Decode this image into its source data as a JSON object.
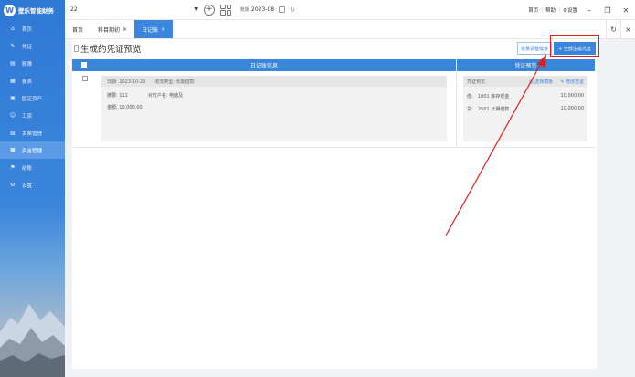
{
  "app": {
    "name": "壁乐智能财务"
  },
  "sidebar": {
    "items": [
      {
        "label": "首页",
        "icon": "home-icon"
      },
      {
        "label": "凭证",
        "icon": "edit-icon"
      },
      {
        "label": "账簿",
        "icon": "book-icon"
      },
      {
        "label": "报表",
        "icon": "report-icon"
      },
      {
        "label": "固定资产",
        "icon": "asset-icon"
      },
      {
        "label": "工资",
        "icon": "user-icon"
      },
      {
        "label": "发票管理",
        "icon": "invoice-icon"
      },
      {
        "label": "资金管理",
        "icon": "fund-icon",
        "active": true
      },
      {
        "label": "结账",
        "icon": "checkout-icon"
      },
      {
        "label": "设置",
        "icon": "settings-icon"
      }
    ]
  },
  "topbar": {
    "book_name": "22",
    "period_label": "账期",
    "period_value": "2023-08",
    "links": [
      "首页",
      "帮助",
      "设置"
    ]
  },
  "tabs": [
    {
      "label": "首页",
      "closable": false,
      "active": false
    },
    {
      "label": "科目期初",
      "closable": true,
      "active": false
    },
    {
      "label": "日记账",
      "closable": true,
      "active": true
    }
  ],
  "page": {
    "title": "生成的凭证预览",
    "btn_template": "批量调整模板",
    "btn_generate": "+ 全部生成凭证"
  },
  "table": {
    "col_journal": "日记账信息",
    "col_voucher": "凭证预览",
    "rows": [
      {
        "date": "日期: 2023-10-23",
        "type": "收支类型: 长期借款",
        "summary": "摘要: 111",
        "counterparty": "对方户名: 电脑及",
        "amount": "金额: 10,000.00",
        "voucher": {
          "head": "凭证预览",
          "link_template": "选择模板",
          "link_edit": "修改凭证",
          "lines": [
            {
              "dir": "借:",
              "account": "1001 库存现金",
              "amount": "10,000.00"
            },
            {
              "dir": "贷:",
              "account": "2501 长期借款",
              "amount": "10,000.00"
            }
          ]
        }
      }
    ]
  },
  "colors": {
    "primary": "#3a86dc",
    "highlight": "#e02020"
  }
}
